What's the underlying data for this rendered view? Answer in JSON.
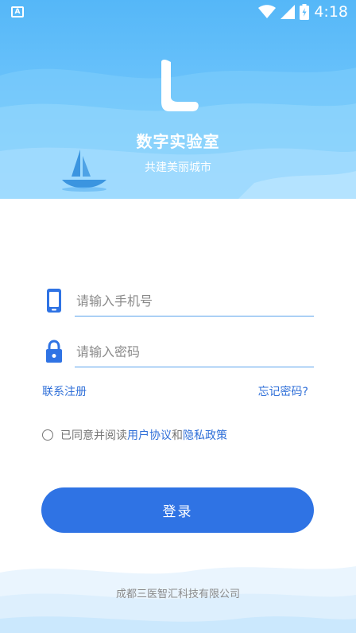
{
  "status_bar": {
    "time": "4:18",
    "notification_icon": "a-icon"
  },
  "header": {
    "title": "数字实验室",
    "subtitle": "共建美丽城市"
  },
  "form": {
    "phone_placeholder": "请输入手机号",
    "password_placeholder": "请输入密码",
    "register_link": "联系注册",
    "forgot_link": "忘记密码?"
  },
  "agreement": {
    "prefix": "已同意并阅读",
    "user_agreement": "用户协议",
    "and": "和",
    "privacy_policy": "隐私政策",
    "checked": false
  },
  "login_button": "登录",
  "footer": {
    "company": "成都三医智汇科技有限公司"
  },
  "colors": {
    "primary": "#2f73e4",
    "link": "#2f6fd8",
    "header_gradient_top": "#55b7f8",
    "underline": "#5aa2ec"
  }
}
